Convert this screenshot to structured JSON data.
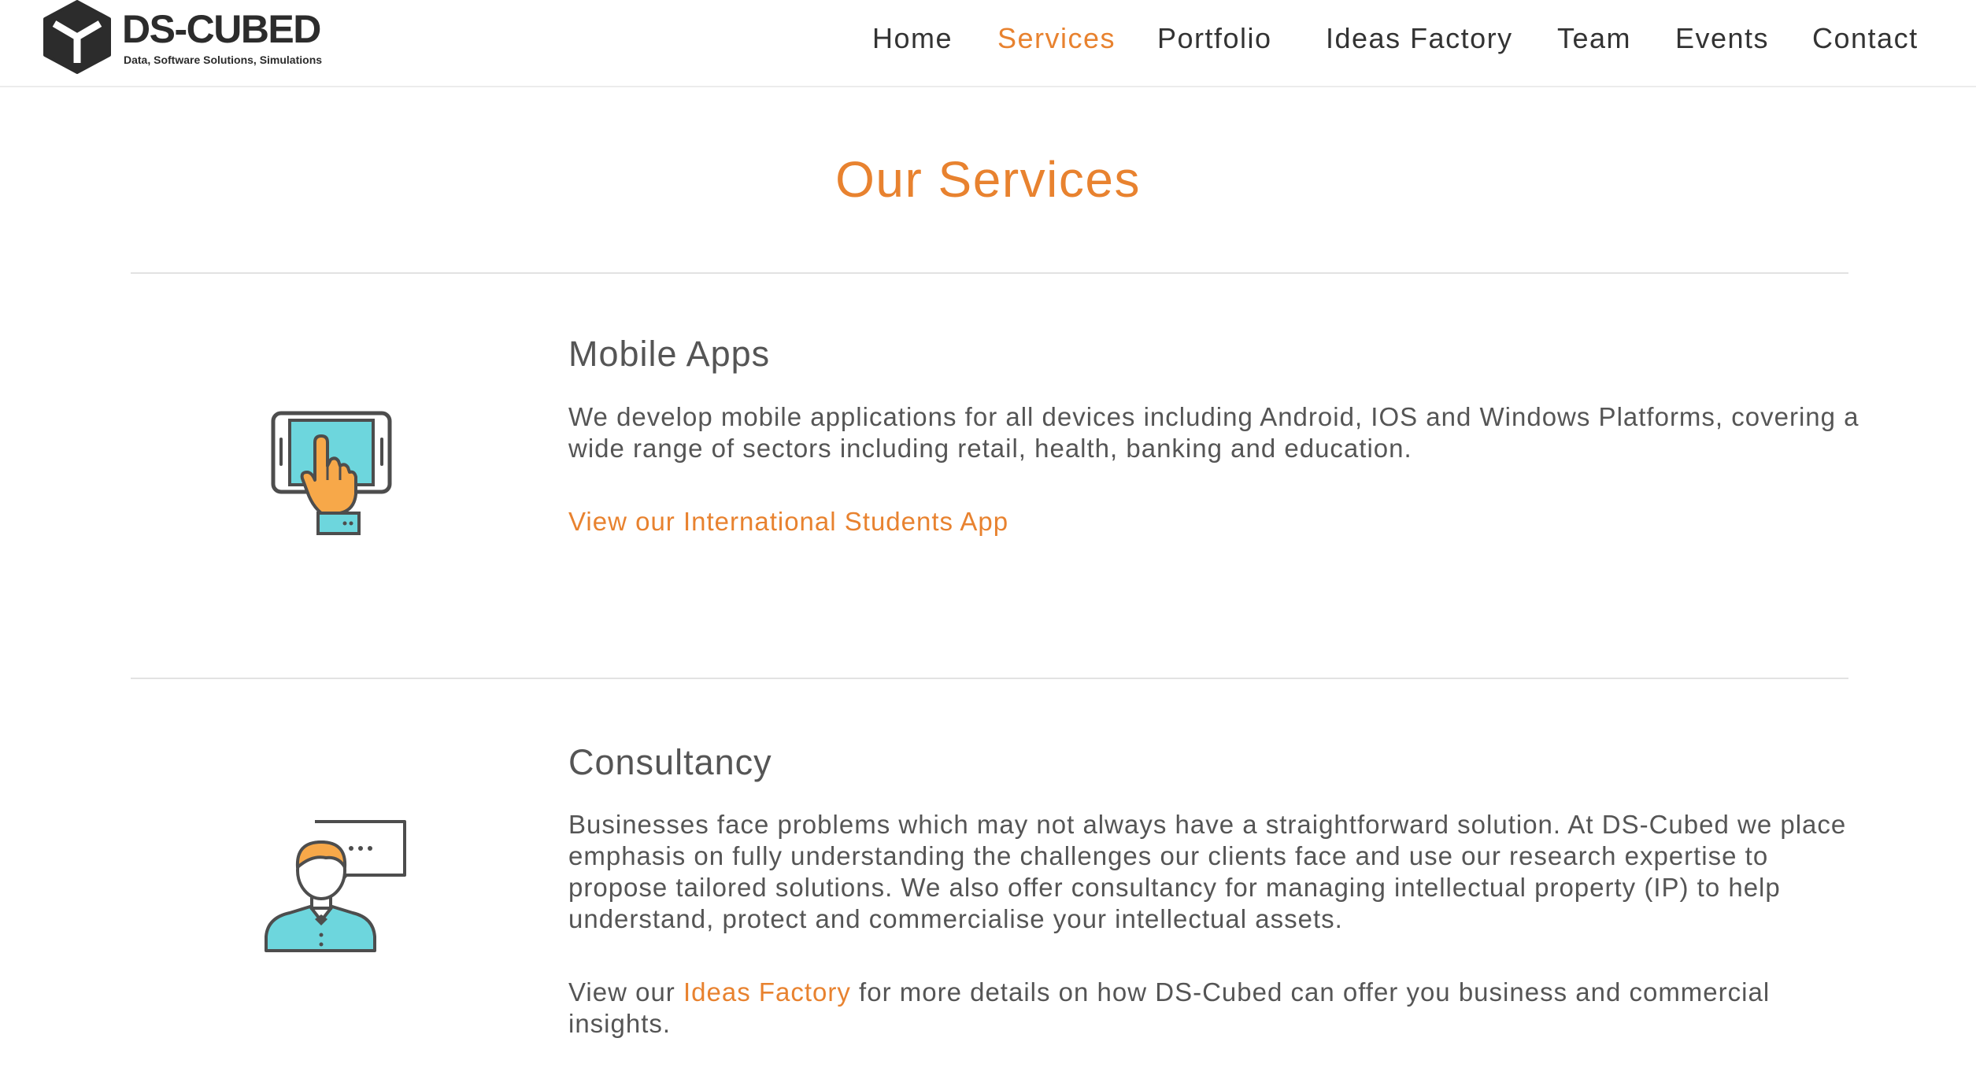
{
  "brand": {
    "name": "DS-CUBED",
    "tagline": "Data, Software Solutions, Simulations",
    "accent_color": "#e8822f",
    "icon_teal": "#6dd6dd",
    "icon_orange": "#f7a849"
  },
  "nav": {
    "items": [
      {
        "label": "Home",
        "active": false
      },
      {
        "label": "Services",
        "active": true
      },
      {
        "label": "Portfolio",
        "active": false
      },
      {
        "label": "Ideas Factory",
        "active": false
      },
      {
        "label": "Team",
        "active": false
      },
      {
        "label": "Events",
        "active": false
      },
      {
        "label": "Contact",
        "active": false
      }
    ]
  },
  "page": {
    "title": "Our Services"
  },
  "services": [
    {
      "icon": "tablet-touch-icon",
      "heading": "Mobile Apps",
      "description": "We develop mobile applications for all devices including Android, IOS and Windows Platforms, covering a wide range of sectors including retail, health, banking and education.",
      "link_label": "View our International Students App"
    },
    {
      "icon": "consultant-speech-icon",
      "heading": "Consultancy",
      "description": "Businesses face problems which may not always have a straightforward solution. At DS-Cubed we place emphasis on fully understanding the challenges our clients face and use our research expertise to propose tailored solutions. We also offer consultancy for managing intellectual property (IP) to help understand, protect and commercialise your intellectual assets.",
      "more_prefix": "View our ",
      "more_link": "Ideas Factory",
      "more_suffix": " for more details on how DS-Cubed can offer you business and commercial insights."
    }
  ]
}
